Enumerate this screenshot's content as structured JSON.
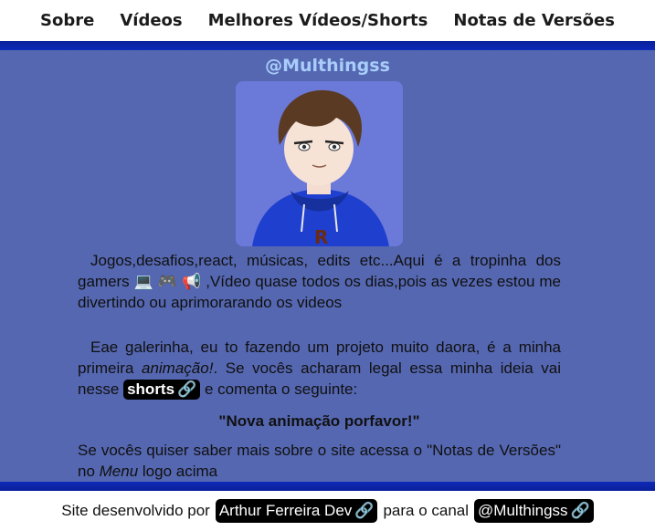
{
  "nav": {
    "items": [
      {
        "label": "Sobre"
      },
      {
        "label": "Vídeos"
      },
      {
        "label": "Melhores Vídeos/Shorts"
      },
      {
        "label": "Notas de Versões"
      }
    ]
  },
  "profile": {
    "handle": "@Multhingss",
    "avatar_desc": "cartoon avatar boy with brown hair in blue hoodie"
  },
  "content": {
    "p1": "Jogos,desafios,react, músicas, edits etc...Aqui é a tropinha dos gamers 💻 🎮 📢 ,Vídeo quase todos os dias,pois as vezes estou me divertindo ou aprimorarando os videos",
    "p2_before": "Eae galerinha, eu to fazendo um projeto muito daora, é a minha primeira ",
    "p2_em": "animação!",
    "p2_mid": ". Se vocês acharam legal essa minha ideia vai nesse ",
    "p2_link": "shorts",
    "p2_after": " e comenta o seguinte:",
    "quote": "\"Nova animação porfavor!\"",
    "p3_before": "Se vocês quiser saber mais sobre o site acessa o \"Notas de Versões\" no ",
    "p3_em": "Menu",
    "p3_after": " logo acima"
  },
  "footer": {
    "text1": "Site desenvolvido por",
    "author_link": "Arthur Ferreira Dev",
    "text2": "para o canal",
    "channel_link": "@Multhingss"
  },
  "colors": {
    "main_bg": "#5567b1",
    "band": "#0d2ab7",
    "handle": "#a8cdfa",
    "avatar_bg": "#6b79d8"
  }
}
